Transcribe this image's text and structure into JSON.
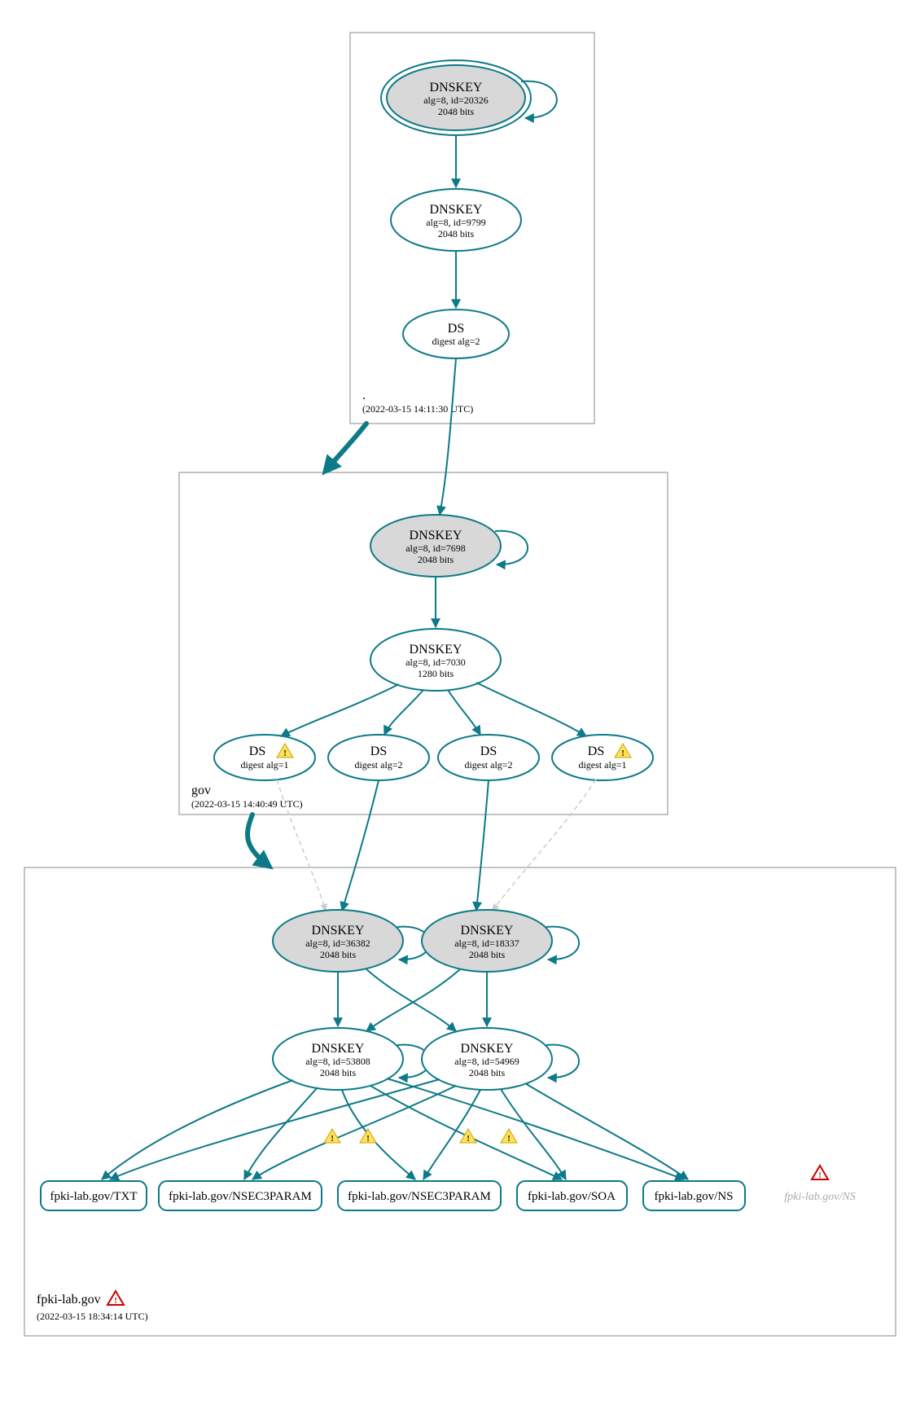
{
  "zones": {
    "root": {
      "label": ".",
      "timestamp": "(2022-03-15 14:11:30 UTC)"
    },
    "gov": {
      "label": "gov",
      "timestamp": "(2022-03-15 14:40:49 UTC)"
    },
    "sld": {
      "label": "fpki-lab.gov",
      "timestamp": "(2022-03-15 18:34:14 UTC)"
    }
  },
  "nodes": {
    "root_ksk": {
      "title": "DNSKEY",
      "line2": "alg=8, id=20326",
      "line3": "2048 bits"
    },
    "root_zsk": {
      "title": "DNSKEY",
      "line2": "alg=8, id=9799",
      "line3": "2048 bits"
    },
    "root_ds": {
      "title": "DS",
      "line2": "digest alg=2"
    },
    "gov_ksk": {
      "title": "DNSKEY",
      "line2": "alg=8, id=7698",
      "line3": "2048 bits"
    },
    "gov_zsk": {
      "title": "DNSKEY",
      "line2": "alg=8, id=7030",
      "line3": "1280 bits"
    },
    "gov_ds1": {
      "title": "DS",
      "line2": "digest alg=1"
    },
    "gov_ds2": {
      "title": "DS",
      "line2": "digest alg=2"
    },
    "gov_ds3": {
      "title": "DS",
      "line2": "digest alg=2"
    },
    "gov_ds4": {
      "title": "DS",
      "line2": "digest alg=1"
    },
    "sld_ksk1": {
      "title": "DNSKEY",
      "line2": "alg=8, id=36382",
      "line3": "2048 bits"
    },
    "sld_ksk2": {
      "title": "DNSKEY",
      "line2": "alg=8, id=18337",
      "line3": "2048 bits"
    },
    "sld_zsk1": {
      "title": "DNSKEY",
      "line2": "alg=8, id=53808",
      "line3": "2048 bits"
    },
    "sld_zsk2": {
      "title": "DNSKEY",
      "line2": "alg=8, id=54969",
      "line3": "2048 bits"
    },
    "rr_txt": {
      "label": "fpki-lab.gov/TXT"
    },
    "rr_n3p1": {
      "label": "fpki-lab.gov/NSEC3PARAM"
    },
    "rr_n3p2": {
      "label": "fpki-lab.gov/NSEC3PARAM"
    },
    "rr_soa": {
      "label": "fpki-lab.gov/SOA"
    },
    "rr_ns": {
      "label": "fpki-lab.gov/NS"
    },
    "rr_ns_grey": {
      "label": "fpki-lab.gov/NS"
    }
  }
}
